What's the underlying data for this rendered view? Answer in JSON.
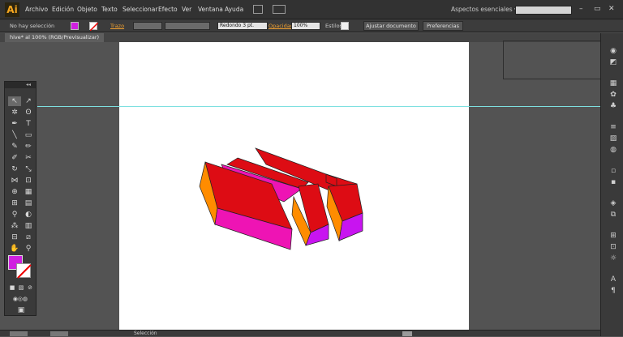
{
  "app": {
    "logo": "Ai"
  },
  "menu": {
    "items": [
      "Archivo",
      "Edición",
      "Objeto",
      "Texto",
      "Seleccionar",
      "Efecto",
      "Ver",
      "Ventana",
      "Ayuda"
    ],
    "workspace": "Aspectos esenciales",
    "workspace_arrow": "▾"
  },
  "window_controls": {
    "minimize": "–",
    "restore": "▭",
    "close": "✕"
  },
  "control_bar": {
    "selection_status": "No hay selección",
    "stroke_label": "Trazo",
    "brush_value": "Redondo 3 pt.",
    "opacity_label": "Opacidad",
    "opacity_value": "100%",
    "style_label": "Estilos",
    "fit_document_button": "Ajustar documento",
    "preferences_button": "Preferencias"
  },
  "document": {
    "tab_title": "hive* al 100% (RGB/Previsualizar)"
  },
  "status_bar": {
    "tool_name": "Selección"
  },
  "colors": {
    "fill": "#d020e0",
    "shape_top": "#dd0c14",
    "shape_magenta": "#ee14b4",
    "shape_orange": "#ff8c00",
    "shape_purple": "#c814f0",
    "guide": "#7ee0e0"
  },
  "icons": {
    "tools": [
      "selection-icon",
      "direct-selection-icon",
      "magic-wand-icon",
      "lasso-icon",
      "pen-icon",
      "type-icon",
      "line-icon",
      "rectangle-icon",
      "paintbrush-icon",
      "pencil-icon",
      "blob-brush-icon",
      "eraser-icon",
      "rotate-icon",
      "scale-icon",
      "width-icon",
      "free-transform-icon",
      "shape-builder-icon",
      "perspective-grid-icon",
      "mesh-icon",
      "gradient-icon",
      "eyedropper-icon",
      "blend-icon",
      "symbol-sprayer-icon",
      "column-graph-icon",
      "artboard-icon",
      "slice-icon",
      "hand-icon",
      "zoom-icon"
    ]
  }
}
